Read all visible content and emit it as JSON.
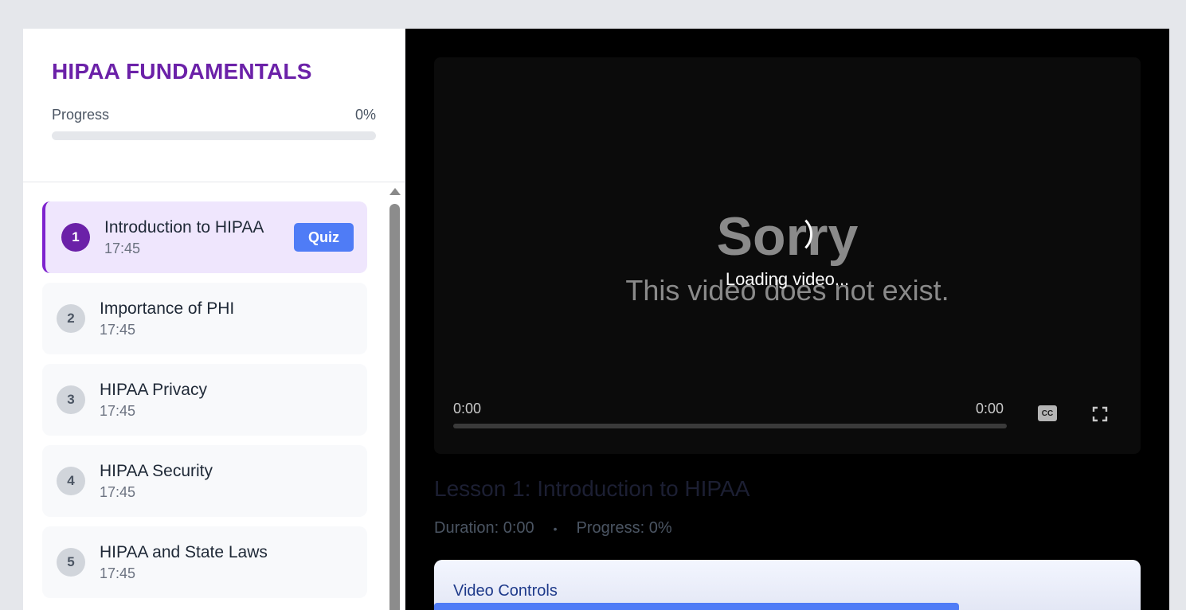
{
  "sidebar": {
    "course_title": "HIPAA FUNDAMENTALS",
    "progress_label": "Progress",
    "progress_value": "0%",
    "progress_fraction": 0,
    "lessons": [
      {
        "number": "1",
        "title": "Introduction to HIPAA",
        "duration": "17:45",
        "active": true,
        "quiz_label": "Quiz"
      },
      {
        "number": "2",
        "title": "Importance of PHI",
        "duration": "17:45"
      },
      {
        "number": "3",
        "title": "HIPAA Privacy",
        "duration": "17:45"
      },
      {
        "number": "4",
        "title": "HIPAA Security",
        "duration": "17:45"
      },
      {
        "number": "5",
        "title": "HIPAA and State Laws",
        "duration": "17:45"
      }
    ]
  },
  "player": {
    "error_title": "Sorry",
    "error_message": "This video does not exist.",
    "loading_text": "Loading video...",
    "current_time": "0:00",
    "total_time": "0:00",
    "cc_label": "CC",
    "cc_icon": "closed-captions-icon",
    "fullscreen_icon": "fullscreen-icon"
  },
  "lesson_info": {
    "heading": "Lesson 1: Introduction to HIPAA",
    "duration_label": "Duration: 0:00",
    "separator": "•",
    "progress_label": "Progress: 0%"
  },
  "controls_panel": {
    "title": "Video Controls"
  },
  "colors": {
    "accent_purple": "#6b21a8",
    "quiz_blue": "#4f7cf6",
    "active_lesson_bg": "#efe6fd"
  }
}
